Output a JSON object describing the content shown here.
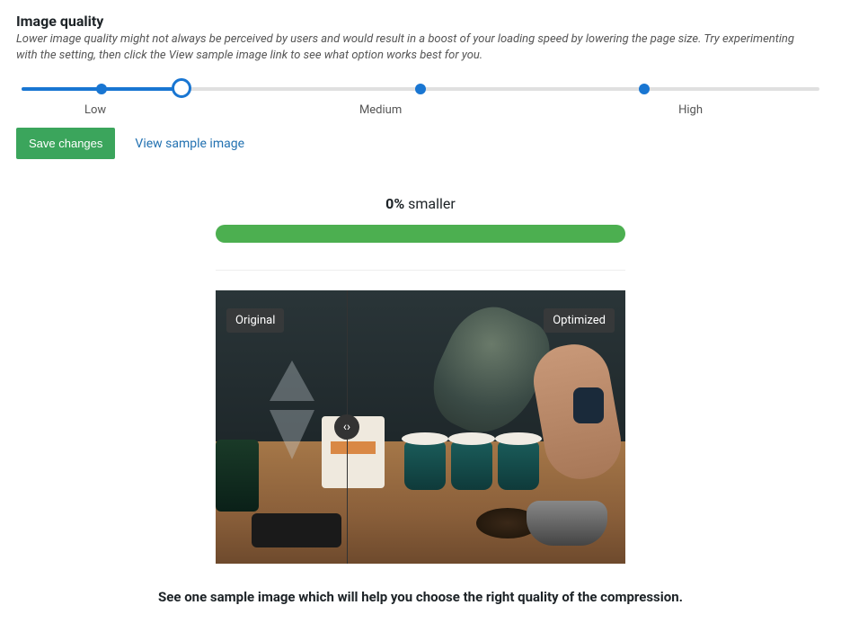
{
  "section": {
    "title": "Image quality",
    "description": "Lower image quality might not always be perceived by users and would result in a boost of your loading speed by lowering the page size. Try experimenting with the setting, then click the View sample image link to see what option works best for you."
  },
  "slider": {
    "labels": {
      "low": "Low",
      "medium": "Medium",
      "high": "High"
    },
    "value_percent": 20
  },
  "actions": {
    "save_label": "Save changes",
    "sample_link": "View sample image"
  },
  "result": {
    "percent": "0%",
    "suffix": " smaller"
  },
  "compare": {
    "original_label": "Original",
    "optimized_label": "Optimized",
    "split_percent": 32
  },
  "footer_text": "See one sample image which will help you choose the right quality of the compression."
}
